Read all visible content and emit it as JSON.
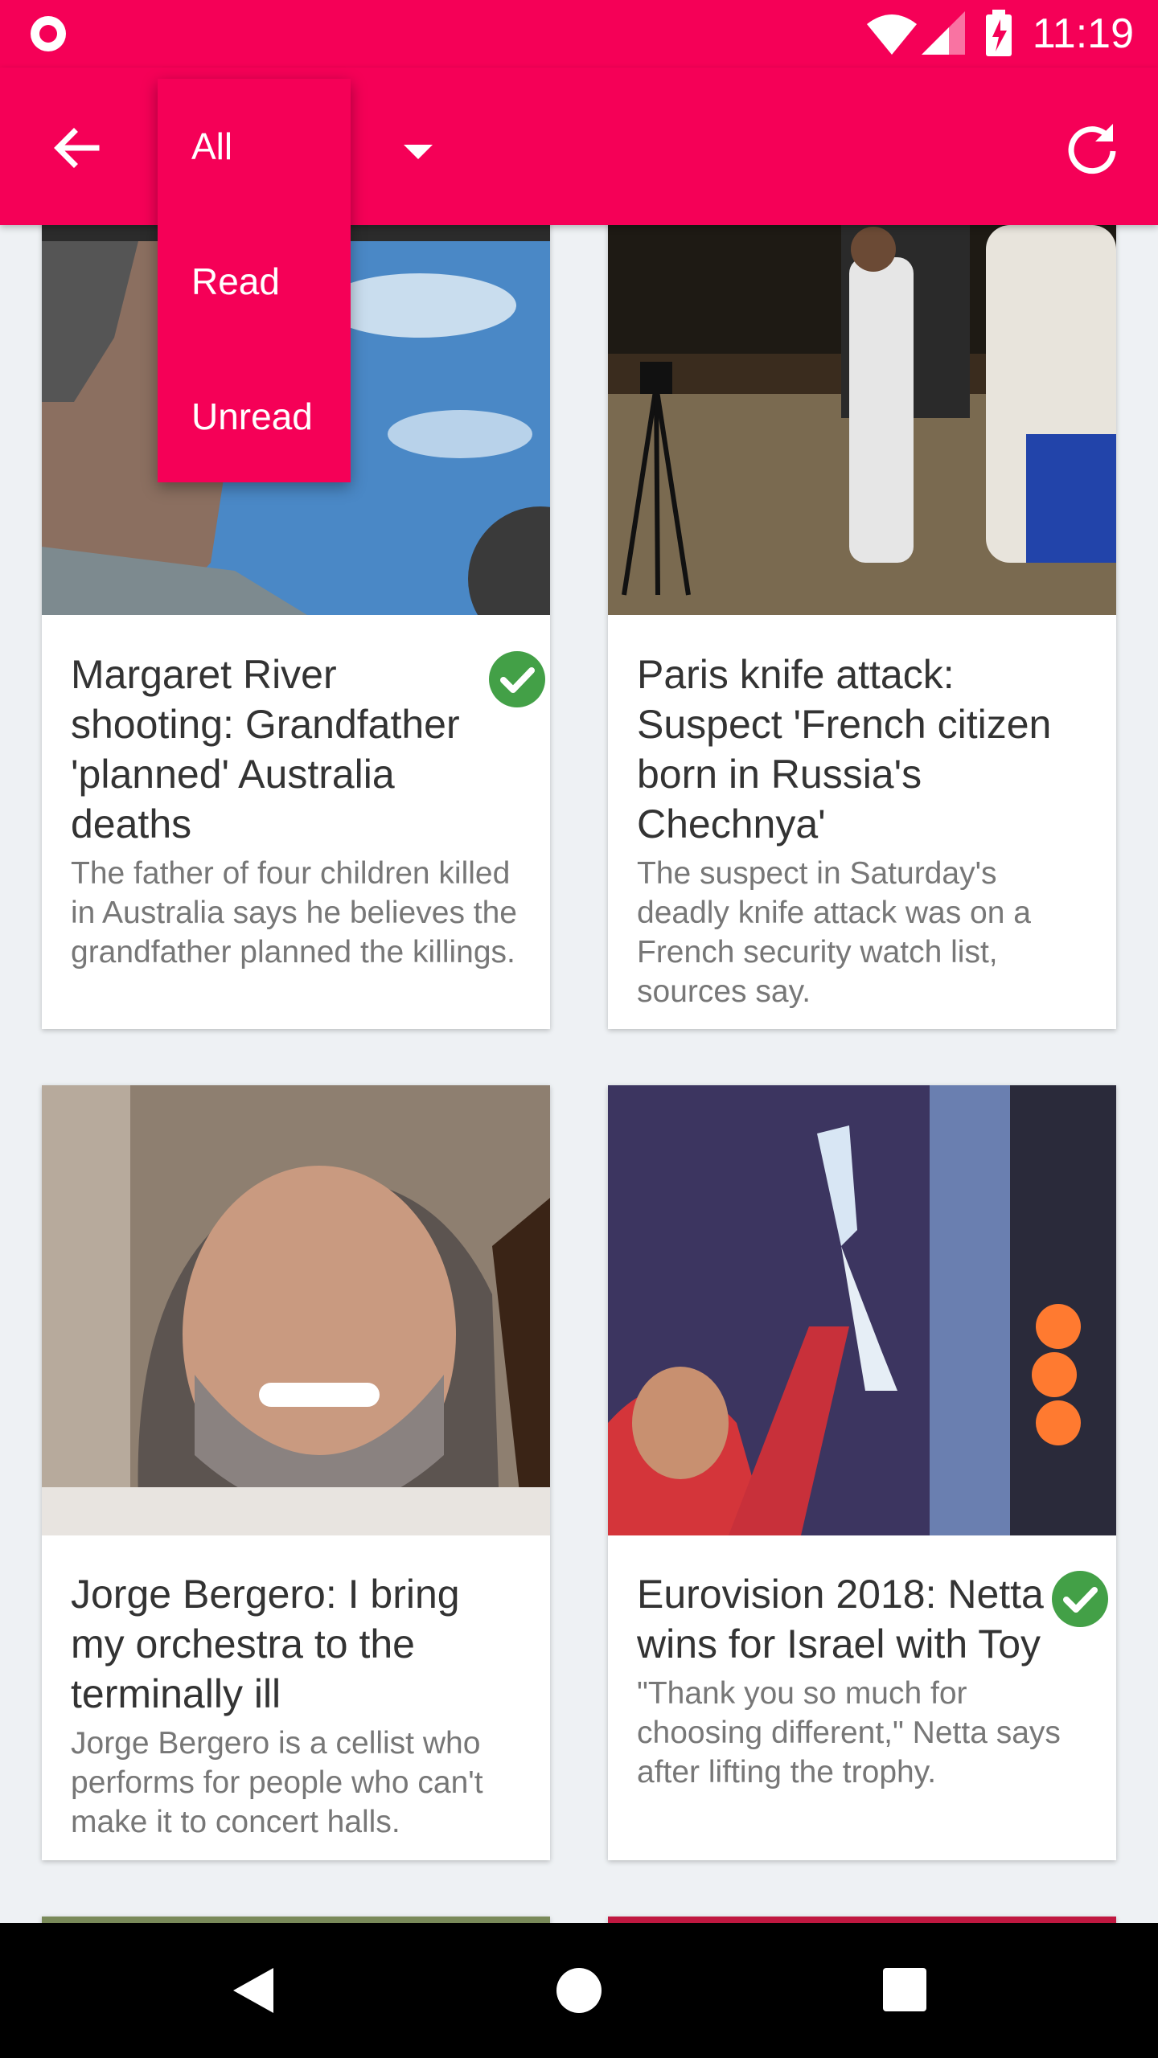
{
  "status_bar": {
    "time": "11:19"
  },
  "filter": {
    "options": [
      "All",
      "Read",
      "Unread"
    ]
  },
  "colors": {
    "accent": "#f50057",
    "check": "#43a047"
  },
  "articles": [
    {
      "title": "Margaret River shooting: Grandfather 'planned' Australia deaths",
      "description": "The father of four children killed in Australia says he believes the grandfather planned the killings.",
      "read": true
    },
    {
      "title": "Paris knife attack: Suspect 'French citizen born in Russia's Chechnya'",
      "description": "The suspect in Saturday's deadly knife attack was on a French security watch list, sources say.",
      "read": false
    },
    {
      "title": "Jorge Bergero: I bring my orchestra to the terminally ill",
      "description": "Jorge Bergero is a cellist who performs for people who can't make it to concert halls.",
      "read": false
    },
    {
      "title": "Eurovision 2018: Netta wins for Israel with Toy",
      "description": "\"Thank you so much for choosing different,\" Netta says after lifting the trophy.",
      "read": true
    }
  ]
}
